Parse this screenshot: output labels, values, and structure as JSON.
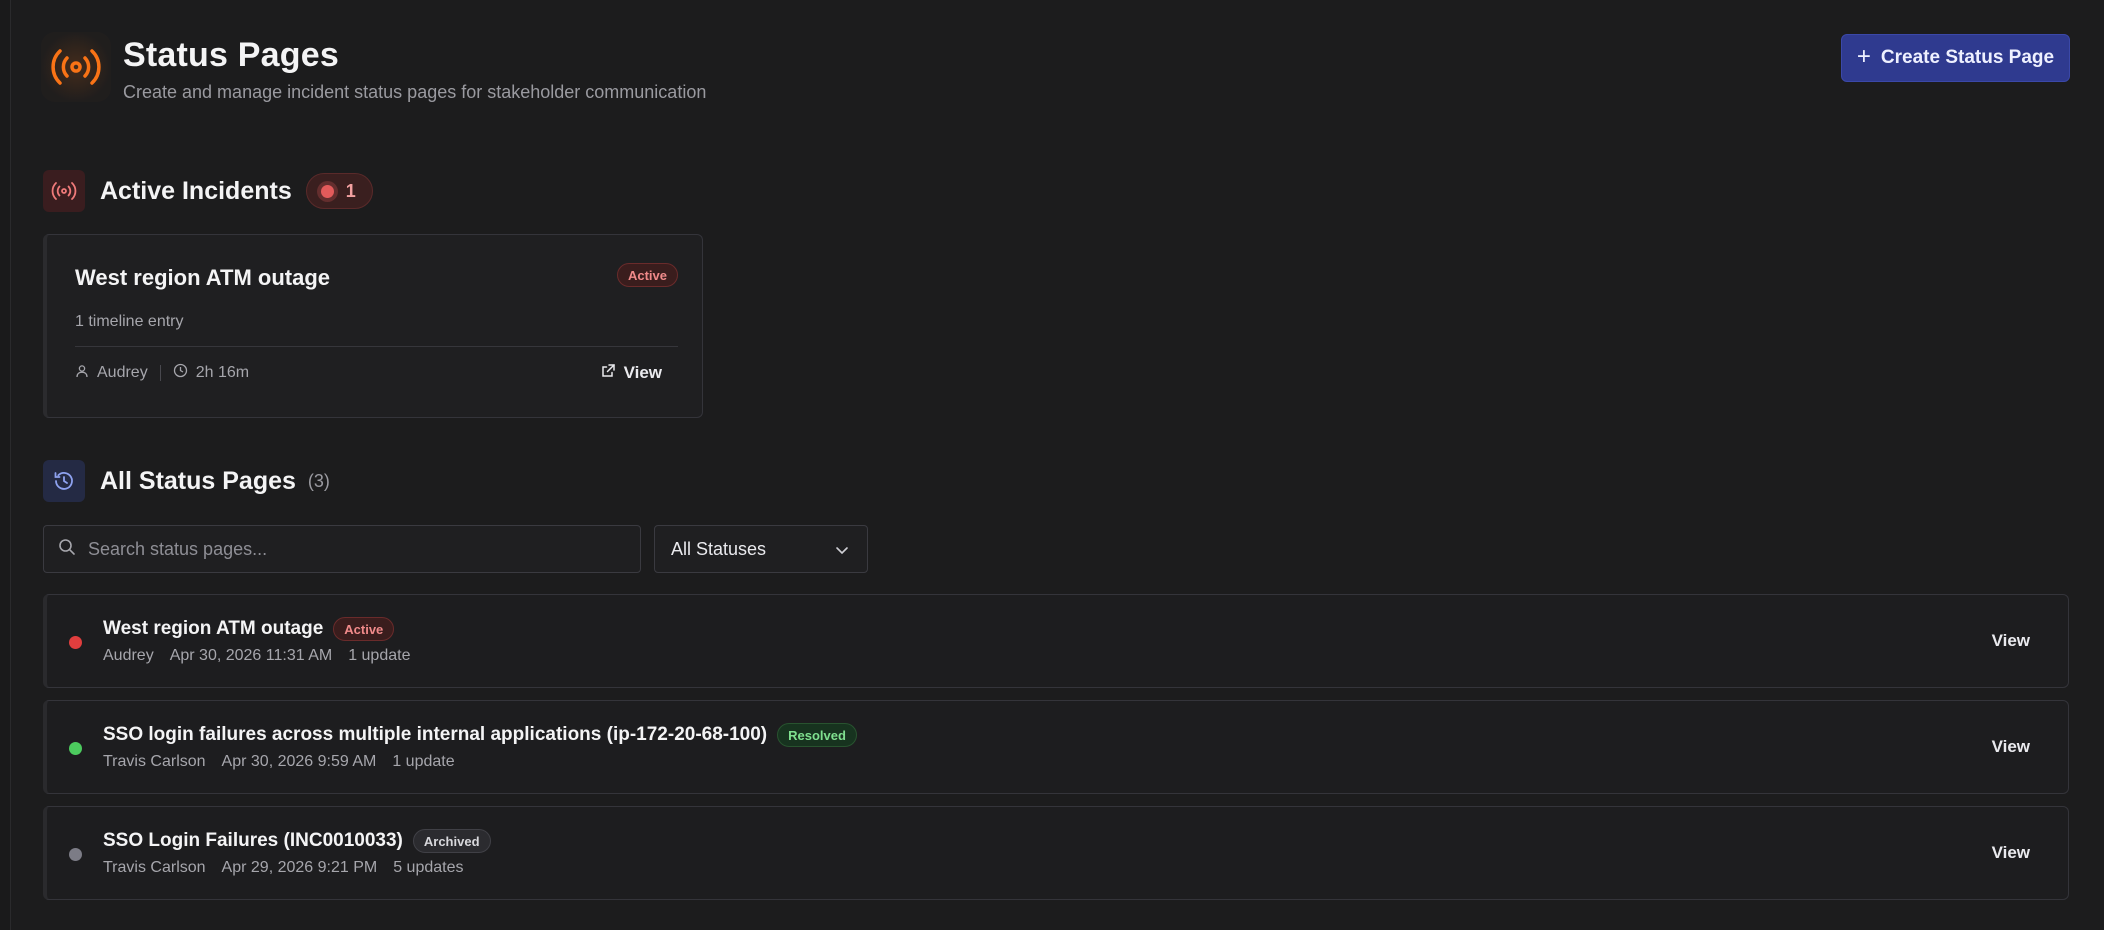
{
  "header": {
    "title": "Status Pages",
    "subtitle": "Create and manage incident status pages for stakeholder communication",
    "create_button": "Create Status Page",
    "brand_icon": "broadcast-icon",
    "accent": "#f97316"
  },
  "active_incidents": {
    "title": "Active Incidents",
    "count": "1",
    "cards": [
      {
        "title": "West region ATM outage",
        "status": "Active",
        "entries": "1 timeline entry",
        "owner": "Audrey",
        "duration": "2h 16m",
        "view": "View"
      }
    ]
  },
  "all_pages": {
    "title": "All Status Pages",
    "count": "(3)",
    "search_placeholder": "Search status pages...",
    "filter_value": "All Statuses",
    "rows": [
      {
        "title": "West region ATM outage",
        "status": "Active",
        "dot_color": "#e03e3e",
        "owner": "Audrey",
        "date": "Apr 30, 2026 11:31 AM",
        "updates": "1 update",
        "view": "View"
      },
      {
        "title": "SSO login failures across multiple internal applications (ip-172-20-68-100)",
        "status": "Resolved",
        "dot_color": "#4ccb5e",
        "owner": "Travis Carlson",
        "date": "Apr 30, 2026 9:59 AM",
        "updates": "1 update",
        "view": "View"
      },
      {
        "title": "SSO Login Failures (INC0010033)",
        "status": "Archived",
        "dot_color": "#7c7c86",
        "owner": "Travis Carlson",
        "date": "Apr 29, 2026 9:21 PM",
        "updates": "5 updates",
        "view": "View"
      }
    ]
  }
}
